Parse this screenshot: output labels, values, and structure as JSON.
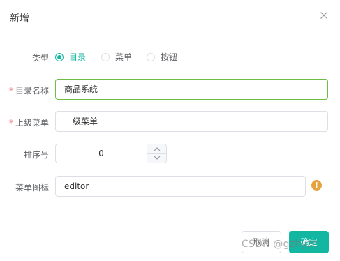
{
  "dialog": {
    "title": "新增",
    "close_icon": "close-icon"
  },
  "form": {
    "type": {
      "label": "类型",
      "options": [
        "目录",
        "菜单",
        "按钮"
      ],
      "selected": "目录"
    },
    "name": {
      "required_mark": "*",
      "label": "目录名称",
      "value": "商品系统"
    },
    "parent": {
      "required_mark": "*",
      "label": "上级菜单",
      "value": "一级菜单"
    },
    "order": {
      "label": "排序号",
      "value": "0"
    },
    "icon": {
      "label": "菜单图标",
      "value": "editor",
      "warning_symbol": "!"
    }
  },
  "footer": {
    "cancel_label": "取消",
    "confirm_label": "确定"
  },
  "watermark": "CSDN @gzhyzc",
  "colors": {
    "accent": "#13b7a1",
    "required": "#f56c6c",
    "warning": "#e6a23c",
    "focus_border": "#6cbd45"
  }
}
